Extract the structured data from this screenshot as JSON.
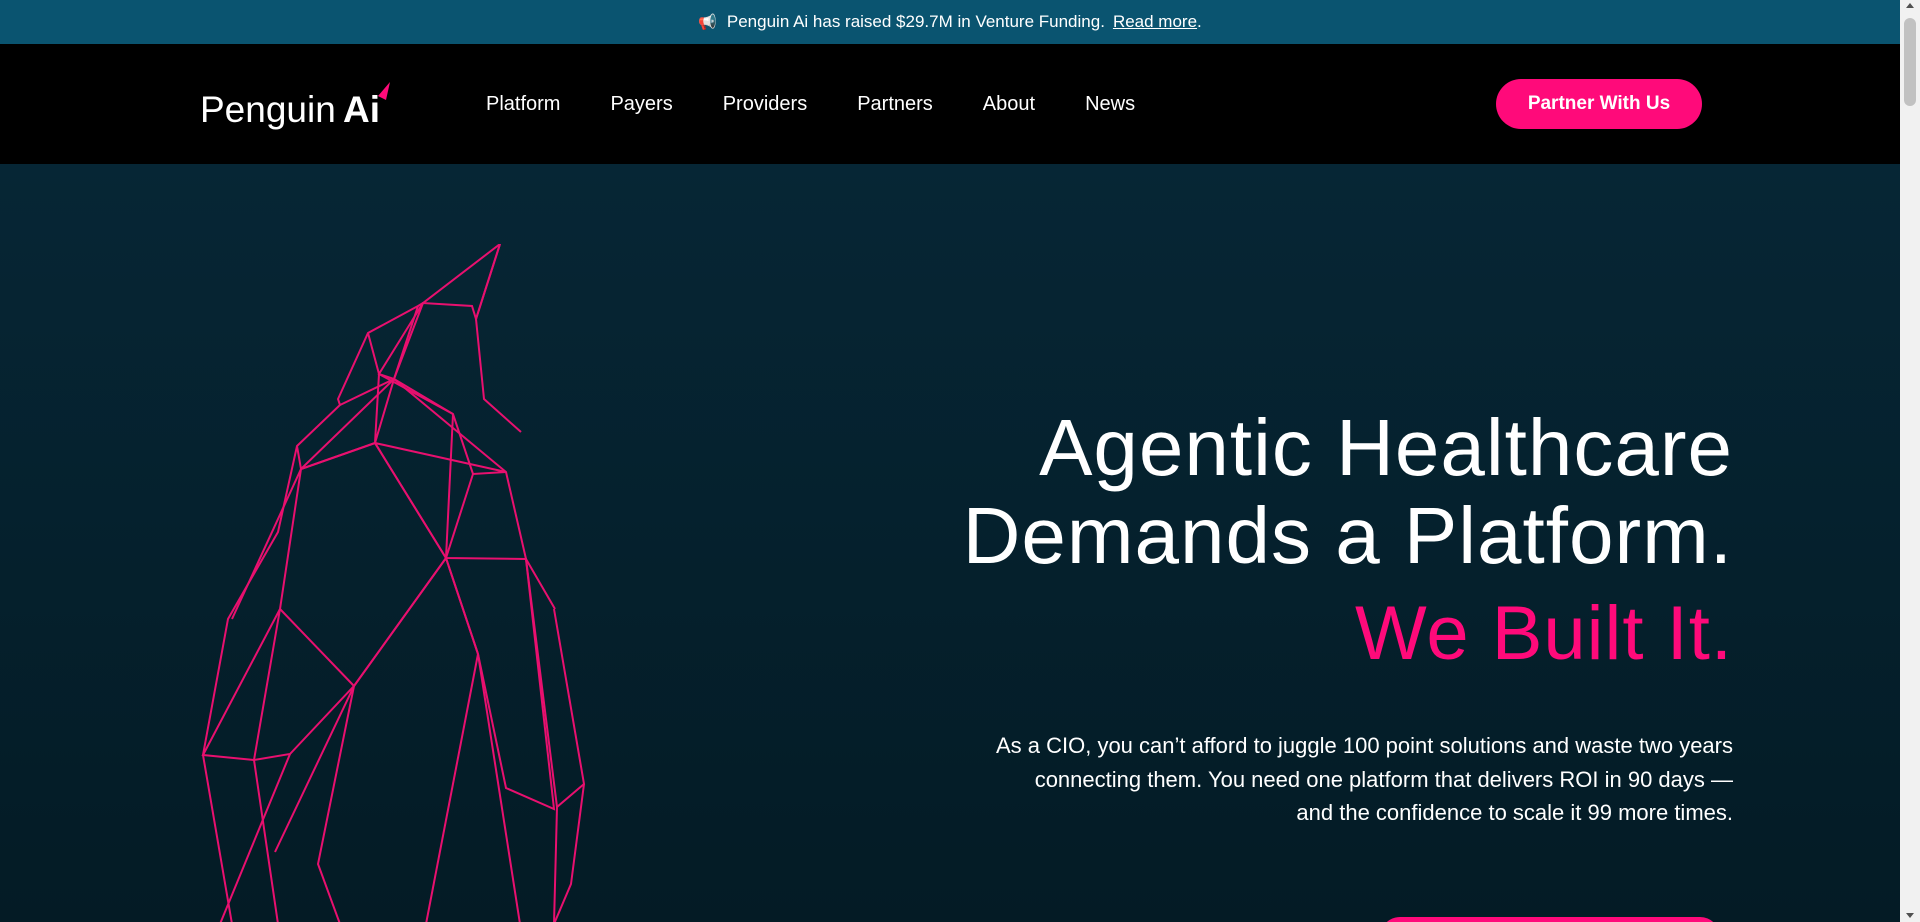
{
  "announcement": {
    "icon": "megaphone-icon",
    "text": "Penguin Ai has raised $29.7M in Venture Funding.",
    "link_label": "Read more",
    "suffix": "."
  },
  "header": {
    "logo_text": "Penguin",
    "logo_ai": "Ai",
    "nav": [
      "Platform",
      "Payers",
      "Providers",
      "Partners",
      "About",
      "News"
    ],
    "cta_label": "Partner With Us"
  },
  "hero": {
    "title_line1": "Agentic Healthcare",
    "title_line2": "Demands a Platform.",
    "subtitle": "We Built It.",
    "body": "As a CIO, you can’t afford to juggle 100 point solutions and waste two years connecting them. You need one platform that delivers ROI in 90 days — and the confidence to scale it 99 more times."
  },
  "colors": {
    "accent": "#ff0a7a",
    "announce_bg": "#0a5470",
    "header_bg": "#000000",
    "hero_bg": "#051e2a"
  }
}
